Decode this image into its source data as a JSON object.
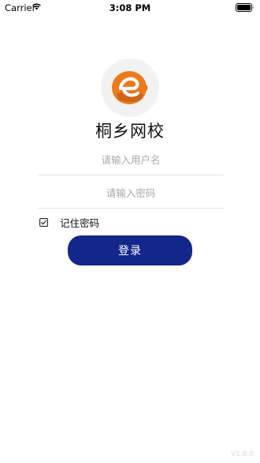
{
  "status_bar": {
    "carrier": "Carrier",
    "time": "3:08 PM"
  },
  "app": {
    "title": "桐乡网校",
    "logo_color": "#ec7a1c",
    "logo_icon": "logo-e-icon"
  },
  "form": {
    "username_placeholder": "请输入用户名",
    "password_placeholder": "请输入密码",
    "username_value": "",
    "password_value": "",
    "remember_checked": true,
    "remember_label": "记住密码",
    "login_label": "登录",
    "login_color": "#13278a"
  },
  "footer": {
    "version": "V1.0.0"
  }
}
